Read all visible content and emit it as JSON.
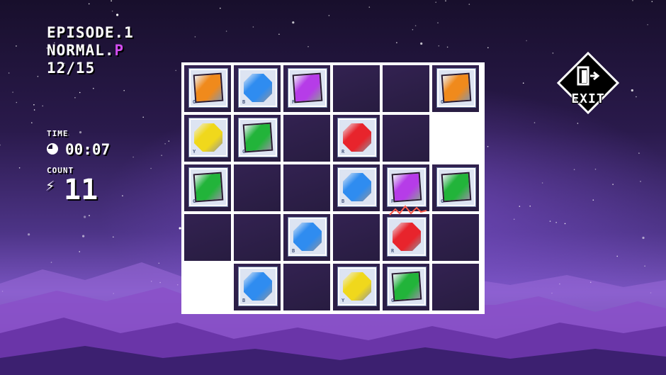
{
  "hud": {
    "episode": "EPISODE.1",
    "difficulty": "NORMAL.",
    "difficulty_suffix": "P",
    "progress": "12/15",
    "time_label": "TIME",
    "time_value": "00:07",
    "count_label": "COUNT",
    "count_value": "11"
  },
  "exit": {
    "label": "EXIT",
    "icon": "door-exit-icon"
  },
  "colors": {
    "orange": "#f08a1c",
    "blue": "#2f8cf0",
    "purple": "#b63ce8",
    "green": "#22b43a",
    "red": "#e8242c",
    "yellow": "#f0d81c",
    "accent": "#d24df0"
  },
  "board": {
    "columns": 6,
    "rows": 5,
    "cells": [
      [
        {
          "gem": "orange",
          "shape": "square",
          "letter": "O"
        },
        {
          "gem": "blue",
          "shape": "octagon",
          "letter": "B"
        },
        {
          "gem": "purple",
          "shape": "square",
          "letter": "P"
        },
        {
          "type": "dark"
        },
        {
          "type": "dark"
        },
        {
          "gem": "orange",
          "shape": "square",
          "letter": "O"
        }
      ],
      [
        {
          "gem": "yellow",
          "shape": "octagon",
          "letter": "Y"
        },
        {
          "gem": "green",
          "shape": "square",
          "letter": "G"
        },
        {
          "type": "dark"
        },
        {
          "gem": "red",
          "shape": "octagon",
          "letter": "R"
        },
        {
          "type": "dark"
        },
        {
          "type": "light"
        }
      ],
      [
        {
          "gem": "green",
          "shape": "square",
          "letter": "G"
        },
        {
          "type": "dark"
        },
        {
          "type": "dark"
        },
        {
          "gem": "blue",
          "shape": "octagon",
          "letter": "B"
        },
        {
          "gem": "purple",
          "shape": "square",
          "letter": "P"
        },
        {
          "gem": "green",
          "shape": "square",
          "letter": "G"
        }
      ],
      [
        {
          "type": "dark"
        },
        {
          "type": "dark"
        },
        {
          "gem": "blue",
          "shape": "octagon",
          "letter": "B"
        },
        {
          "type": "dark"
        },
        {
          "gem": "red",
          "shape": "octagon",
          "letter": "R"
        },
        {
          "type": "dark"
        }
      ],
      [
        {
          "type": "light"
        },
        {
          "gem": "blue",
          "shape": "octagon",
          "letter": "B"
        },
        {
          "type": "dark"
        },
        {
          "gem": "yellow",
          "shape": "octagon",
          "letter": "Y"
        },
        {
          "gem": "green",
          "shape": "square",
          "letter": "G"
        },
        {
          "type": "dark"
        }
      ]
    ]
  }
}
